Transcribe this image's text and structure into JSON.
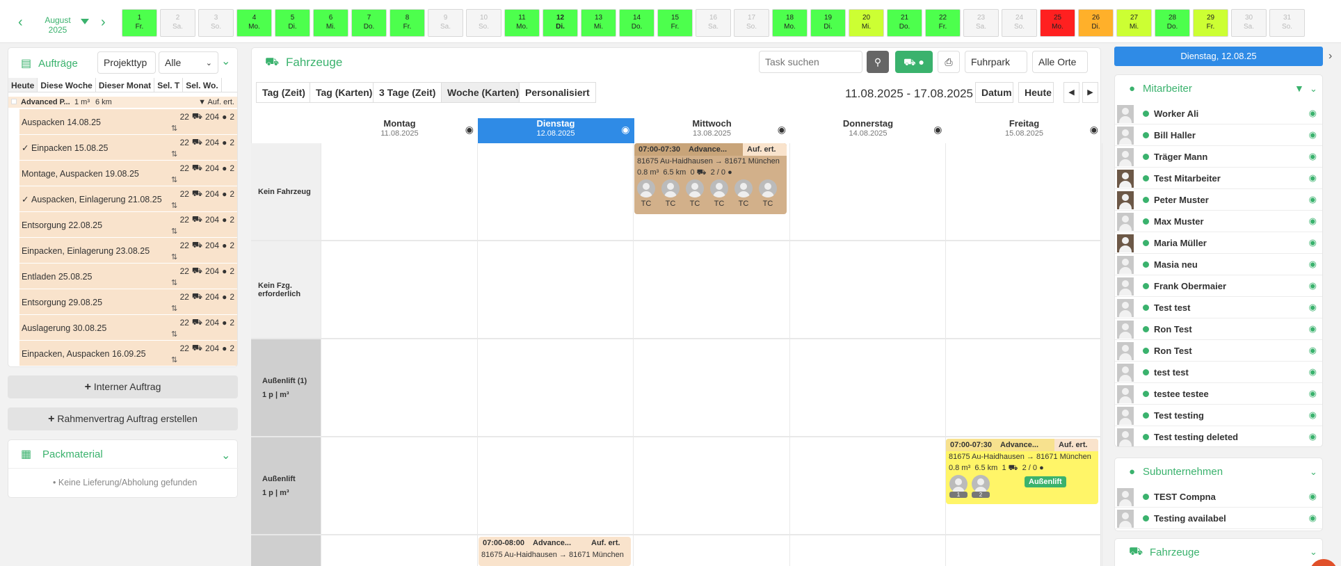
{
  "month": {
    "name": "August",
    "year": "2025"
  },
  "days": [
    {
      "num": "1",
      "wd": "Fr.",
      "color": "#4dff4d"
    },
    {
      "num": "2",
      "wd": "Sa.",
      "color": "weekend"
    },
    {
      "num": "3",
      "wd": "So.",
      "color": "weekend"
    },
    {
      "num": "4",
      "wd": "Mo.",
      "color": "#4dff4d"
    },
    {
      "num": "5",
      "wd": "Di.",
      "color": "#4dff4d"
    },
    {
      "num": "6",
      "wd": "Mi.",
      "color": "#4dff4d"
    },
    {
      "num": "7",
      "wd": "Do.",
      "color": "#4dff4d"
    },
    {
      "num": "8",
      "wd": "Fr.",
      "color": "#4dff4d"
    },
    {
      "num": "9",
      "wd": "Sa.",
      "color": "weekend"
    },
    {
      "num": "10",
      "wd": "So.",
      "color": "weekend"
    },
    {
      "num": "11",
      "wd": "Mo.",
      "color": "#4dff4d"
    },
    {
      "num": "12",
      "wd": "Di.",
      "color": "#4dff4d",
      "selected": true
    },
    {
      "num": "13",
      "wd": "Mi.",
      "color": "#4dff4d"
    },
    {
      "num": "14",
      "wd": "Do.",
      "color": "#4dff4d"
    },
    {
      "num": "15",
      "wd": "Fr.",
      "color": "#4dff4d"
    },
    {
      "num": "16",
      "wd": "Sa.",
      "color": "weekend"
    },
    {
      "num": "17",
      "wd": "So.",
      "color": "weekend"
    },
    {
      "num": "18",
      "wd": "Mo.",
      "color": "#4dff4d"
    },
    {
      "num": "19",
      "wd": "Di.",
      "color": "#4dff4d"
    },
    {
      "num": "20",
      "wd": "Mi.",
      "color": "#ccff33"
    },
    {
      "num": "21",
      "wd": "Do.",
      "color": "#4dff4d"
    },
    {
      "num": "22",
      "wd": "Fr.",
      "color": "#4dff4d"
    },
    {
      "num": "23",
      "wd": "Sa.",
      "color": "weekend"
    },
    {
      "num": "24",
      "wd": "So.",
      "color": "weekend"
    },
    {
      "num": "25",
      "wd": "Mo.",
      "color": "#ff2020"
    },
    {
      "num": "26",
      "wd": "Di.",
      "color": "#ffb02a"
    },
    {
      "num": "27",
      "wd": "Mi.",
      "color": "#ccff33"
    },
    {
      "num": "28",
      "wd": "Do.",
      "color": "#4dff4d"
    },
    {
      "num": "29",
      "wd": "Fr.",
      "color": "#ccff33"
    },
    {
      "num": "30",
      "wd": "Sa.",
      "color": "weekend"
    },
    {
      "num": "31",
      "wd": "So.",
      "color": "weekend"
    }
  ],
  "left": {
    "title": "Aufträge",
    "filter_type": "Projekttyp",
    "filter_all": "Alle",
    "tabs": [
      "Heute",
      "Diese Woche",
      "Dieser Monat",
      "Sel. T",
      "Sel. Wo."
    ],
    "group": {
      "label": "Advanced P...",
      "volume": "1 m³",
      "distance": "6 km",
      "status": "Auf. ert."
    },
    "orders": [
      {
        "name": "Auspacken 14.08.25",
        "checked": false
      },
      {
        "name": "Einpacken 15.08.25",
        "checked": true
      },
      {
        "name": "Montage, Auspacken 19.08.25",
        "checked": false
      },
      {
        "name": "Auspacken, Einlagerung 21.08.25",
        "checked": true
      },
      {
        "name": "Entsorgung 22.08.25",
        "checked": false
      },
      {
        "name": "Einpacken, Einlagerung 23.08.25",
        "checked": false
      },
      {
        "name": "Entladen 25.08.25",
        "checked": false
      },
      {
        "name": "Entsorgung 29.08.25",
        "checked": false
      },
      {
        "name": "Auslagerung 30.08.25",
        "checked": false
      },
      {
        "name": "Einpacken, Auspacken 16.09.25",
        "checked": false
      }
    ],
    "order_meta": {
      "a": "22",
      "b": "204",
      "c": "2"
    },
    "btn_internal": "Interner Auftrag",
    "btn_frame": "Rahmenvertrag Auftrag erstellen",
    "packmaterial": {
      "title": "Packmaterial",
      "empty": "Keine Lieferung/Abholung gefunden"
    }
  },
  "center": {
    "title": "Fahrzeuge",
    "search_placeholder": "Task suchen",
    "fleet": "Fuhrpark",
    "locations": "Alle Orte",
    "views": [
      "Tag (Zeit)",
      "Tag (Karten)",
      "3 Tage (Zeit)",
      "Woche (Karten)",
      "Personalisiert"
    ],
    "range": "11.08.2025 - 17.08.2025",
    "btn_date": "Datum",
    "btn_today": "Heute",
    "columns": [
      {
        "day": "Montag",
        "date": "11.08.2025"
      },
      {
        "day": "Dienstag",
        "date": "12.08.2025",
        "selected": true
      },
      {
        "day": "Mittwoch",
        "date": "13.08.2025"
      },
      {
        "day": "Donnerstag",
        "date": "14.08.2025"
      },
      {
        "day": "Freitag",
        "date": "15.08.2025"
      }
    ],
    "rows": [
      {
        "label": "Kein Fahrzeug",
        "sub": ""
      },
      {
        "label": "Kein Fzg.",
        "sub": "erforderlich"
      },
      {
        "label": "Außenlift (1)",
        "sub": "1 p | m³"
      },
      {
        "label": "Außenlift",
        "sub": "1 p | m³"
      }
    ],
    "card1": {
      "time": "07:00-07:30",
      "name": "Advance...",
      "status": "Auf. ert.",
      "route": "81675 Au-Haidhausen → 81671 München",
      "vol": "0.8 m³",
      "dist": "6.5 km",
      "veh": "0",
      "staff": "2 / 0",
      "initials": "TC"
    },
    "card2": {
      "time": "07:00-07:30",
      "name": "Advance...",
      "status": "Auf. ert.",
      "route": "81675 Au-Haidhausen → 81671 München",
      "vol": "0.8 m³",
      "dist": "6.5 km",
      "veh": "1",
      "staff": "2 / 0",
      "badge": "Außenlift",
      "av1": "1",
      "av2": "2"
    },
    "card3": {
      "time": "07:00-08:00",
      "name": "Advance...",
      "status": "Auf. ert.",
      "route": "81675 Au-Haidhausen → 81671 München"
    }
  },
  "right": {
    "date": "Dienstag, 12.08.25",
    "staff_title": "Mitarbeiter",
    "staff": [
      "Worker Ali",
      "Bill Haller",
      "Träger Mann",
      "Test Mitarbeiter",
      "Peter Muster",
      "Max Muster",
      "Maria Müller",
      "Masia neu",
      "Frank Obermaier",
      "Test test",
      "Ron Test",
      "Ron Test",
      "test test",
      "testee testee",
      "Test testing",
      "Test testing deleted"
    ],
    "sub_title": "Subunternehmen",
    "subs": [
      "TEST Compna",
      "Testing availabel"
    ],
    "vehicles_title": "Fahrzeuge"
  }
}
